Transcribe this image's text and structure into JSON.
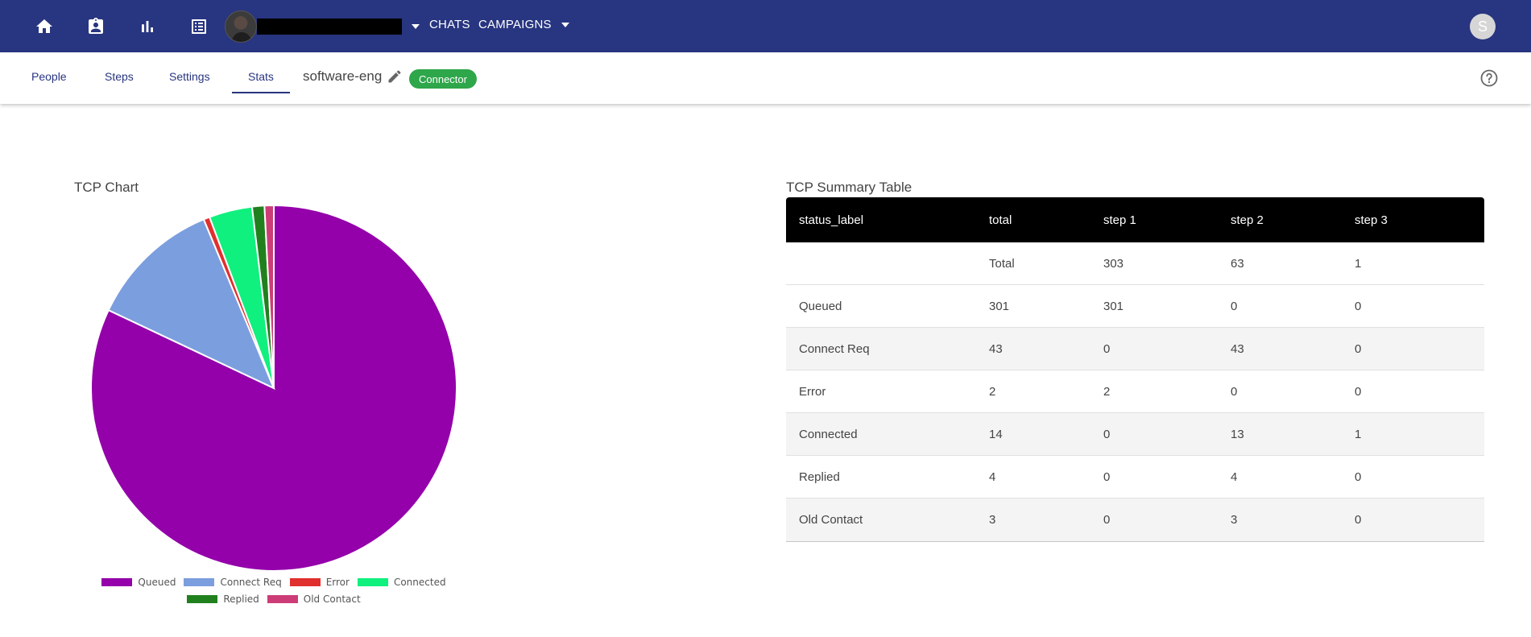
{
  "topbar": {
    "chats_label": "CHATS",
    "campaigns_label": "CAMPAIGNS",
    "profile_initial": "S",
    "background": "#283580"
  },
  "subbar": {
    "tabs": [
      {
        "label": "People"
      },
      {
        "label": "Steps"
      },
      {
        "label": "Settings"
      },
      {
        "label": "Stats",
        "active": true
      }
    ],
    "campaign_name": "software-eng",
    "badge_label": "Connector",
    "badge_color": "#2ea64a"
  },
  "chart_data": {
    "type": "pie",
    "title": "TCP Chart",
    "categories": [
      "Queued",
      "Connect Req",
      "Error",
      "Connected",
      "Replied",
      "Old Contact"
    ],
    "values": [
      301,
      43,
      2,
      14,
      4,
      3
    ],
    "colors": [
      "#9400aa",
      "#7b9ede",
      "#e0302e",
      "#10f07e",
      "#21801e",
      "#cc3d78"
    ],
    "legend_position": "bottom"
  },
  "table": {
    "title": "TCP Summary Table",
    "columns": [
      "status_label",
      "total",
      "step 1",
      "step 2",
      "step 3"
    ],
    "rows": [
      [
        "",
        "Total",
        "303",
        "63",
        "1"
      ],
      [
        "Queued",
        "301",
        "301",
        "0",
        "0"
      ],
      [
        "Connect Req",
        "43",
        "0",
        "43",
        "0"
      ],
      [
        "Error",
        "2",
        "2",
        "0",
        "0"
      ],
      [
        "Connected",
        "14",
        "0",
        "13",
        "1"
      ],
      [
        "Replied",
        "4",
        "0",
        "4",
        "0"
      ],
      [
        "Old Contact",
        "3",
        "0",
        "3",
        "0"
      ]
    ]
  }
}
